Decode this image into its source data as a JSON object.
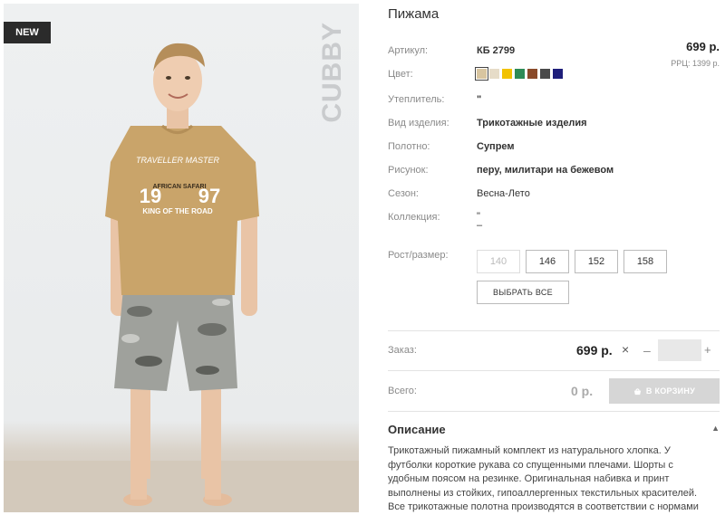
{
  "product": {
    "title": "Пижама",
    "badge": "NEW",
    "brand_mark": "CUBBY",
    "price": "699 р.",
    "rrp": "РРЦ: 1399 р."
  },
  "specs": [
    {
      "label": "Артикул:",
      "value": "КБ 2799"
    },
    {
      "label": "Цвет:",
      "value": ""
    },
    {
      "label": "Утеплитель:",
      "value": "\""
    },
    {
      "label": "Вид изделия:",
      "value": "Трикотажные изделия"
    },
    {
      "label": "Полотно:",
      "value": "Супрем"
    },
    {
      "label": "Рисунок:",
      "value": "перу, милитари на бежевом"
    },
    {
      "label": "Сезон:",
      "value": "Весна-Лето"
    },
    {
      "label": "Коллекция:",
      "value": "\" –"
    }
  ],
  "colors": [
    "#d8c5a0",
    "#e6dcc8",
    "#f2c200",
    "#2e8b57",
    "#8a4a2a",
    "#4a4a4a",
    "#1e1e7a"
  ],
  "sizes": {
    "label": "Рост/размер:",
    "options": [
      "140",
      "146",
      "152",
      "158"
    ],
    "select_all": "ВЫБРАТЬ ВСЕ"
  },
  "order": {
    "label": "Заказ:",
    "price": "699 р.",
    "remove": "×",
    "minus": "–",
    "plus": "+"
  },
  "total": {
    "label": "Всего:",
    "price": "0 р.",
    "cart_button": "В КОРЗИНУ"
  },
  "description": {
    "heading": "Описание",
    "text": "Трикотажный пижамный комплект из натурального хлопка. У футболки короткие рукава со спущенными плечами. Шорты с удобным поясом на резинке. Оригинальная набивка и принт выполнены из стойких, гипоаллергенных текстильных красителей. Все трикотажные полотна производятся в соответствии с нормами"
  },
  "tshirt_print": {
    "line1": "TRAVELLER MASTER",
    "line2": "AFRICAN SAFARI",
    "line3": "KING OF THE ROAD",
    "num_left": "19",
    "num_right": "97"
  }
}
